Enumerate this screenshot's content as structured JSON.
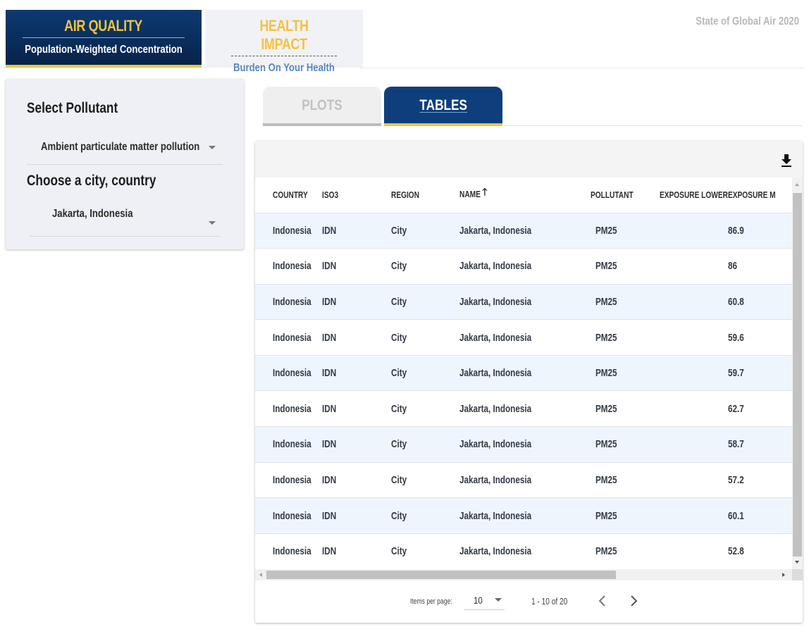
{
  "header": {
    "tabs": [
      {
        "title": "AIR QUALITY",
        "subtitle": "Population-Weighted Concentration",
        "active": true
      },
      {
        "title": "HEALTH IMPACT",
        "subtitle": "Burden On Your Health",
        "active": false
      }
    ],
    "site_title": "State of Global Air 2020"
  },
  "filters": {
    "pollutant_label": "Select Pollutant",
    "pollutant_value": "Ambient particulate matter pollution",
    "location_label": "Choose a city, country",
    "location_value": "Jakarta, Indonesia"
  },
  "view_tabs": [
    {
      "label": "PLOTS",
      "active": false
    },
    {
      "label": "TABLES",
      "active": true
    }
  ],
  "icons": {
    "download": "download-icon",
    "sort": "arrow-up-icon",
    "prev": "chevron-left-icon",
    "next": "chevron-right-icon",
    "dropdown": "caret-down-icon"
  },
  "table": {
    "columns": [
      "COUNTRY",
      "ISO3",
      "REGION",
      "NAME",
      "POLLUTANT",
      "EXPOSURE LOWER",
      "EXPOSURE M"
    ],
    "sort_column": "NAME",
    "sort_arrow": "🡑",
    "rows": [
      [
        "Indonesia",
        "IDN",
        "City",
        "Jakarta, Indonesia",
        "PM25",
        "",
        "86.9"
      ],
      [
        "Indonesia",
        "IDN",
        "City",
        "Jakarta, Indonesia",
        "PM25",
        "",
        "86"
      ],
      [
        "Indonesia",
        "IDN",
        "City",
        "Jakarta, Indonesia",
        "PM25",
        "",
        "60.8"
      ],
      [
        "Indonesia",
        "IDN",
        "City",
        "Jakarta, Indonesia",
        "PM25",
        "",
        "59.6"
      ],
      [
        "Indonesia",
        "IDN",
        "City",
        "Jakarta, Indonesia",
        "PM25",
        "",
        "59.7"
      ],
      [
        "Indonesia",
        "IDN",
        "City",
        "Jakarta, Indonesia",
        "PM25",
        "",
        "62.7"
      ],
      [
        "Indonesia",
        "IDN",
        "City",
        "Jakarta, Indonesia",
        "PM25",
        "",
        "58.7"
      ],
      [
        "Indonesia",
        "IDN",
        "City",
        "Jakarta, Indonesia",
        "PM25",
        "",
        "57.2"
      ],
      [
        "Indonesia",
        "IDN",
        "City",
        "Jakarta, Indonesia",
        "PM25",
        "",
        "60.1"
      ],
      [
        "Indonesia",
        "IDN",
        "City",
        "Jakarta, Indonesia",
        "PM25",
        "",
        "52.8"
      ]
    ]
  },
  "paginator": {
    "items_per_page_label": "Items per page:",
    "items_per_page_value": "10",
    "range_label": "1 - 10 of 20"
  },
  "colors": {
    "brand_navy": "#0e3f7c",
    "accent_yellow": "#f3c445",
    "row_stripe": "#eef5fd",
    "panel_bg": "#eef0f5"
  }
}
